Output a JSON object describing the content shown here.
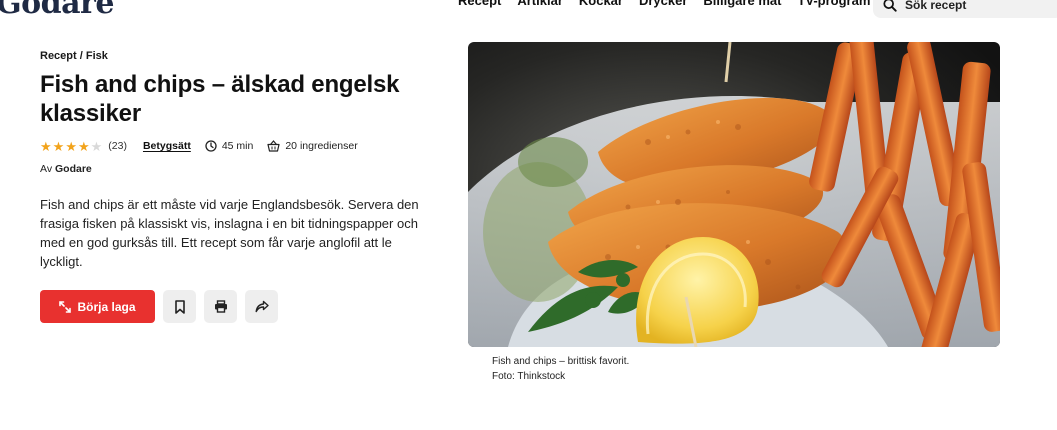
{
  "header": {
    "logo": "Godare",
    "nav": [
      "Recept",
      "Artiklar",
      "Kockar",
      "Drycker",
      "Billigare mat",
      "TV-program"
    ],
    "search_placeholder": "Sök recept"
  },
  "breadcrumb": {
    "section": "Recept",
    "separator": "/",
    "category": "Fisk"
  },
  "recipe": {
    "title": "Fish and chips – älskad engelsk klassiker",
    "rating_stars": 4,
    "rating_max": 5,
    "rating_count": "(23)",
    "rate_label": "Betygsätt",
    "time": "45 min",
    "ingredients": "20 ingredienser",
    "author_prefix": "Av",
    "author": "Godare",
    "description": "Fish and chips är ett måste vid varje Englandsbesök. Servera den frasiga fisken på klassiskt vis, inslagna i en bit tidningspapper och med en god gurksås till. Ett recept som får varje anglofil att le lyckligt."
  },
  "actions": {
    "start_label": "Börja laga",
    "icons": [
      "bookmark-icon",
      "print-icon",
      "share-icon"
    ]
  },
  "image": {
    "caption": "Fish and chips – brittisk favorit.",
    "credit": "Foto: Thinkstock"
  },
  "colors": {
    "accent": "#e8312f",
    "star": "#f2a31b",
    "brand": "#1f2a44"
  }
}
